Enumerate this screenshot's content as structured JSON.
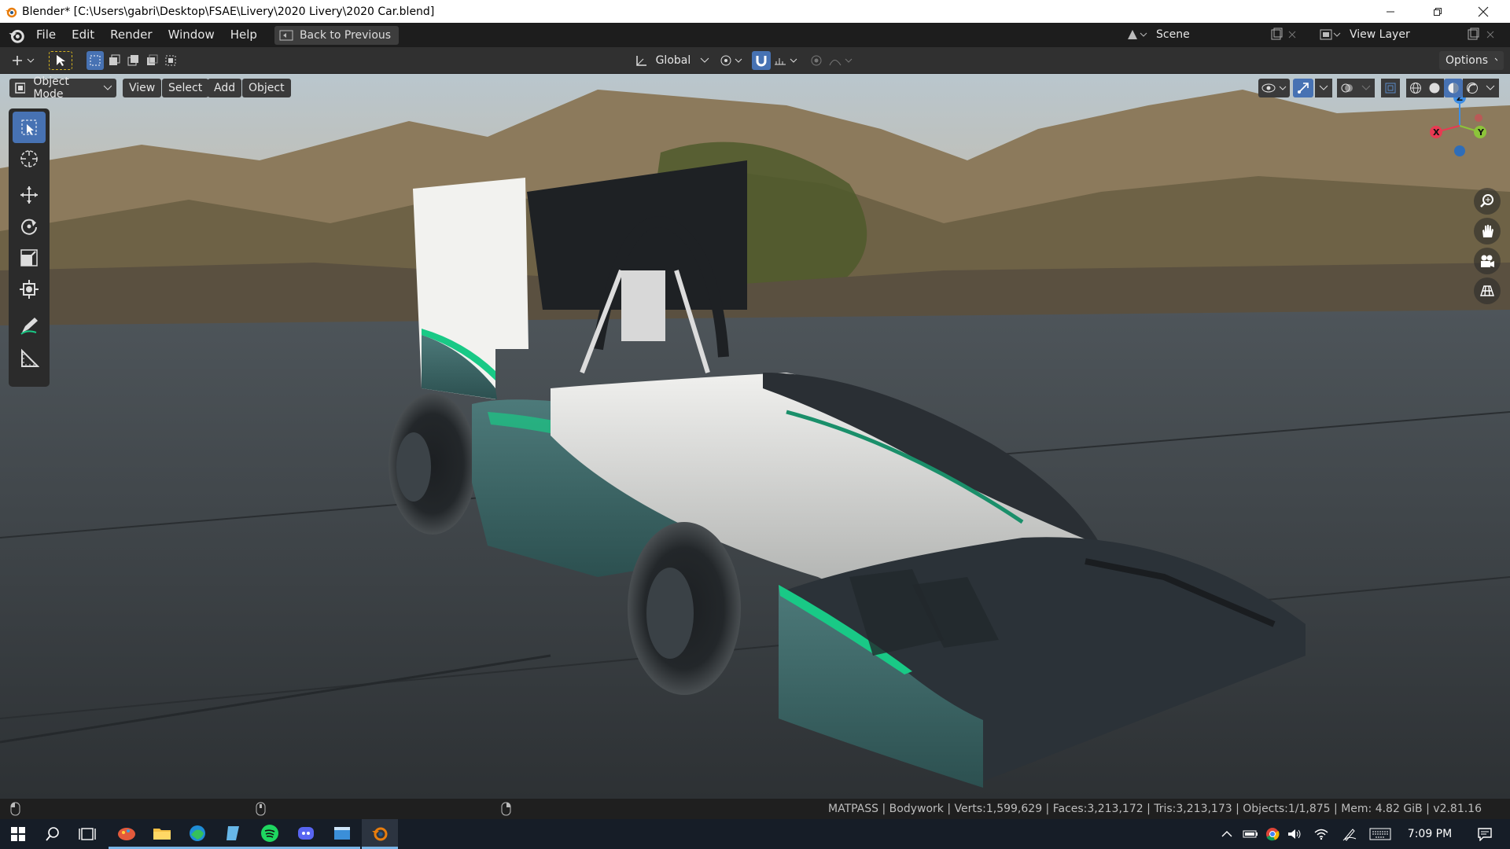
{
  "window": {
    "title": "Blender* [C:\\Users\\gabri\\Desktop\\FSAE\\Livery\\2020 Livery\\2020 Car.blend]"
  },
  "menubar": {
    "items": [
      "File",
      "Edit",
      "Render",
      "Window",
      "Help"
    ],
    "back_button": "Back to Previous",
    "scene_label": "Scene",
    "view_layer_label": "View Layer"
  },
  "tool_header": {
    "transform_orientation": "Global",
    "options_label": "Options"
  },
  "viewport_header": {
    "mode": "Object Mode",
    "menus": [
      "View",
      "Select",
      "Add",
      "Object"
    ]
  },
  "gizmo": {
    "x": "X",
    "y": "Y",
    "z": "Z"
  },
  "statusbar": {
    "stats": "MATPASS | Bodywork | Verts:1,599,629 | Faces:3,213,172 | Tris:3,213,173 | Objects:1/1,875 | Mem: 4.82 GiB | v2.81.16"
  },
  "taskbar": {
    "time": "7:09 PM"
  },
  "colors": {
    "accent_blue": "#4772b3",
    "axis_x": "#e83a52",
    "axis_y": "#8cc43a",
    "axis_z": "#3c8ee6",
    "livery_green": "#19c986",
    "livery_teal": "#3a6363"
  },
  "icons": {
    "app": "blender-logo-icon",
    "tools": [
      "select-box-icon",
      "cursor-icon",
      "move-icon",
      "rotate-icon",
      "scale-icon",
      "transform-icon",
      "annotate-icon",
      "measure-icon"
    ],
    "nav": [
      "zoom-icon",
      "pan-hand-icon",
      "camera-view-icon",
      "grid-ortho-icon"
    ]
  }
}
